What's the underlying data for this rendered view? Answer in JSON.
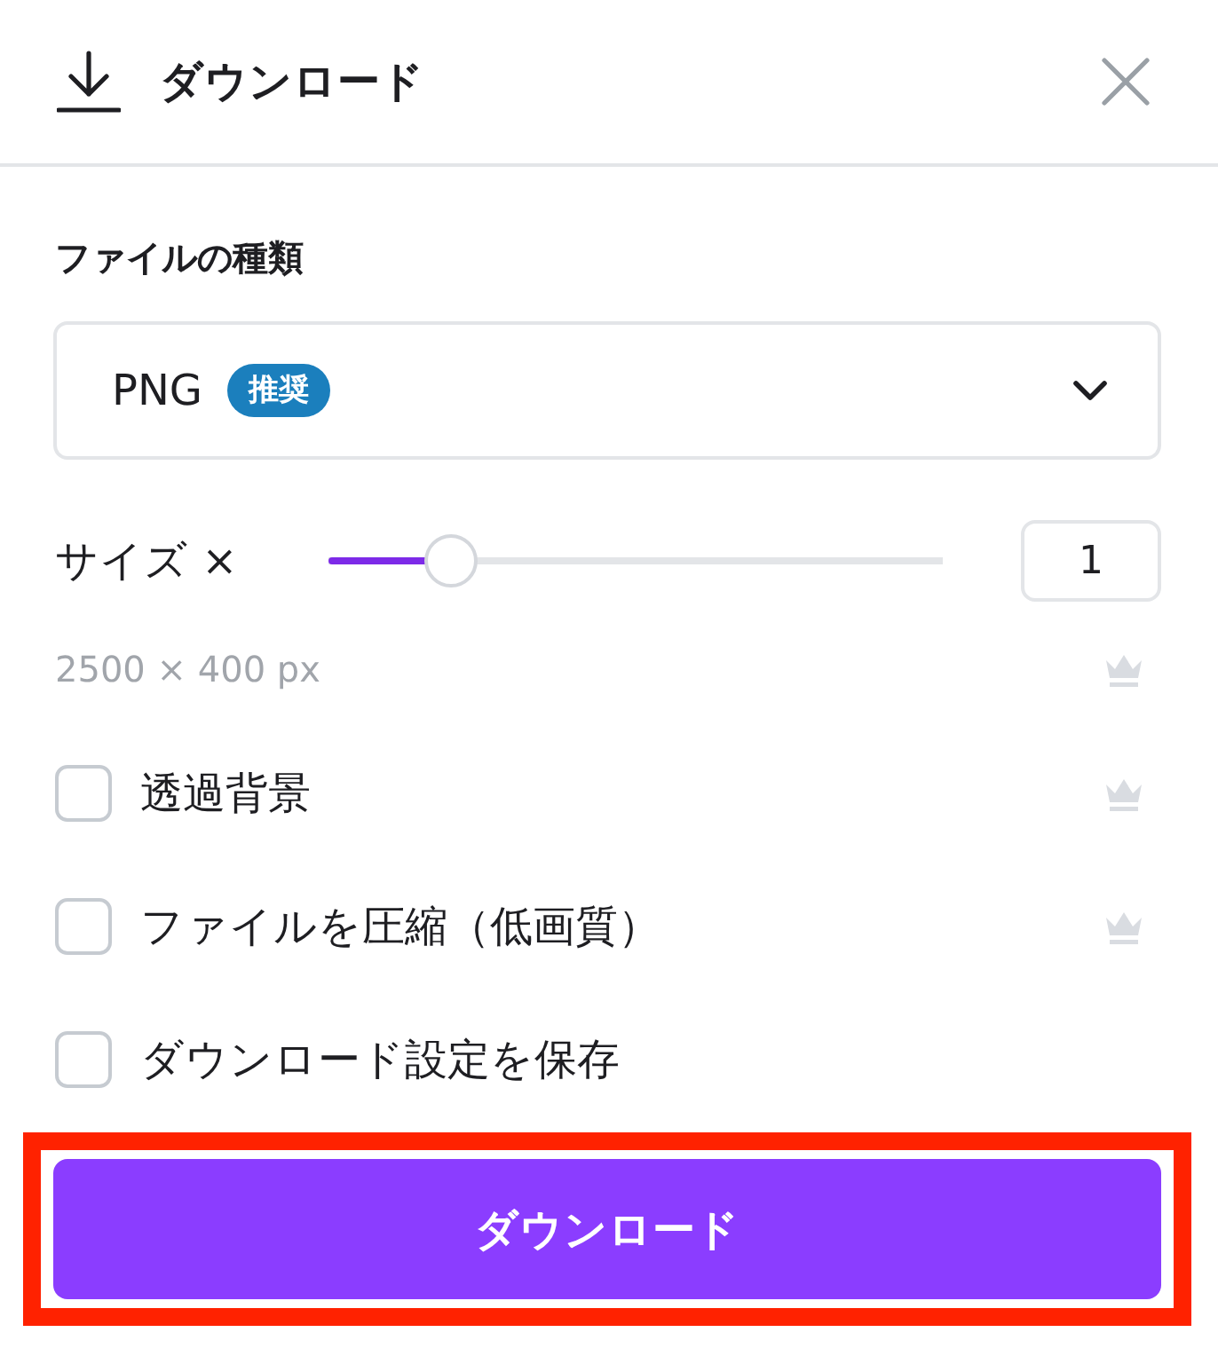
{
  "header": {
    "title": "ダウンロード"
  },
  "file_type": {
    "label": "ファイルの種類",
    "value": "PNG",
    "badge": "推奨"
  },
  "size": {
    "label": "サイズ ×",
    "level": 0.2,
    "value": "1",
    "dimensions": "2500 × 400 px",
    "premium": true
  },
  "options": [
    {
      "label": "透過背景",
      "checked": false,
      "premium": true
    },
    {
      "label": "ファイルを圧縮（低画質）",
      "checked": false,
      "premium": true
    },
    {
      "label": "ダウンロード設定を保存",
      "checked": false,
      "premium": false
    }
  ],
  "download_button": {
    "label": "ダウンロード",
    "highlighted": true
  }
}
